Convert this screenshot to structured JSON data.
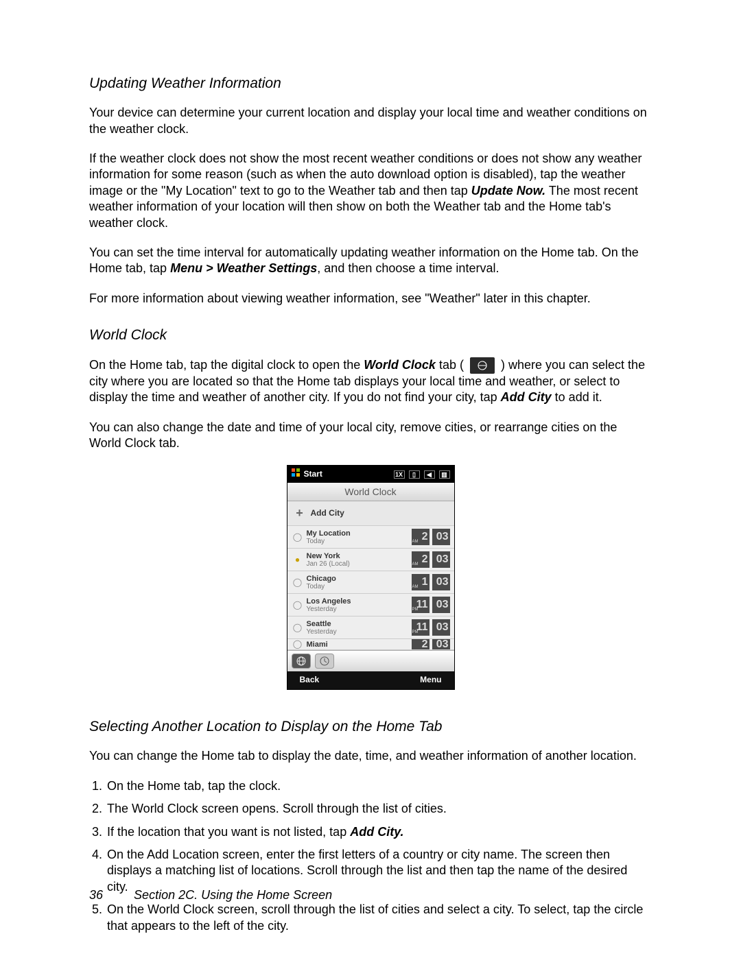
{
  "heading1": "Updating Weather Information",
  "p1": "Your device can determine your current location and display your local time and weather conditions on the weather clock.",
  "p2a": "If the weather clock does not show the most recent weather conditions or does not show any weather information for some reason (such as when the auto download option is disabled), tap the weather image or the \"My Location\" text to go to the Weather tab and then tap ",
  "p2b": "Update Now.",
  "p2c": " The most recent weather information of your location will then show on both the Weather tab and the Home tab's weather clock.",
  "p3a": "You can set the time interval for automatically updating weather information on the Home tab. On the Home tab, tap ",
  "p3b": "Menu > Weather Settings",
  "p3c": ", and then choose a time interval.",
  "p4": "For more information about viewing weather information, see \"Weather\" later in this chapter.",
  "heading2": "World Clock",
  "p5a": "On the Home tab, tap the digital clock to open the ",
  "p5b": "World Clock",
  "p5c": " tab ( ",
  "p5d": " ) where you can select the city where you are located so that the Home tab displays your local time and weather, or select to display the time and weather of another city. If you do not find your city, tap ",
  "p5e": "Add City",
  "p5f": " to add it.",
  "p6": "You can also change the date and time of your local city, remove cities, or rearrange cities on the World Clock tab.",
  "phone": {
    "start": "Start",
    "title": "World Clock",
    "add": "Add City",
    "back": "Back",
    "menu": "Menu",
    "cities": [
      {
        "name": "My Location",
        "sub": "Today",
        "hr": "2",
        "ap": "AM",
        "mn": "03",
        "dot": "◯"
      },
      {
        "name": "New York",
        "sub": "Jan 26  (Local)",
        "hr": "2",
        "ap": "AM",
        "mn": "03",
        "dot": "☀"
      },
      {
        "name": "Chicago",
        "sub": "Today",
        "hr": "1",
        "ap": "AM",
        "mn": "03",
        "dot": "◯"
      },
      {
        "name": "Los Angeles",
        "sub": "Yesterday",
        "hr": "11",
        "ap": "PM",
        "mn": "03",
        "dot": "◯"
      },
      {
        "name": "Seattle",
        "sub": "Yesterday",
        "hr": "11",
        "ap": "PM",
        "mn": "03",
        "dot": "◯"
      },
      {
        "name": "Miami",
        "sub": "",
        "hr": "2",
        "ap": "",
        "mn": "03",
        "dot": "◯"
      }
    ]
  },
  "heading3": "Selecting Another Location to Display on the Home Tab",
  "p7": "You can change the Home tab to display the date, time, and weather information of another location.",
  "steps": {
    "s1": "On the Home tab, tap the clock.",
    "s2": "The World Clock screen opens. Scroll through the list of cities.",
    "s3a": "If the location that you want is not listed, tap ",
    "s3b": "Add City.",
    "s4": "On the Add Location screen, enter the first letters of a country or city name. The screen then displays a matching list of locations. Scroll through the list and then tap the name of the desired city.",
    "s5": "On the World Clock screen, scroll through the list of cities and select a city. To select, tap the circle that appears to the left of the city."
  },
  "footer": {
    "page": "36",
    "section": "Section 2C. Using the Home Screen"
  }
}
